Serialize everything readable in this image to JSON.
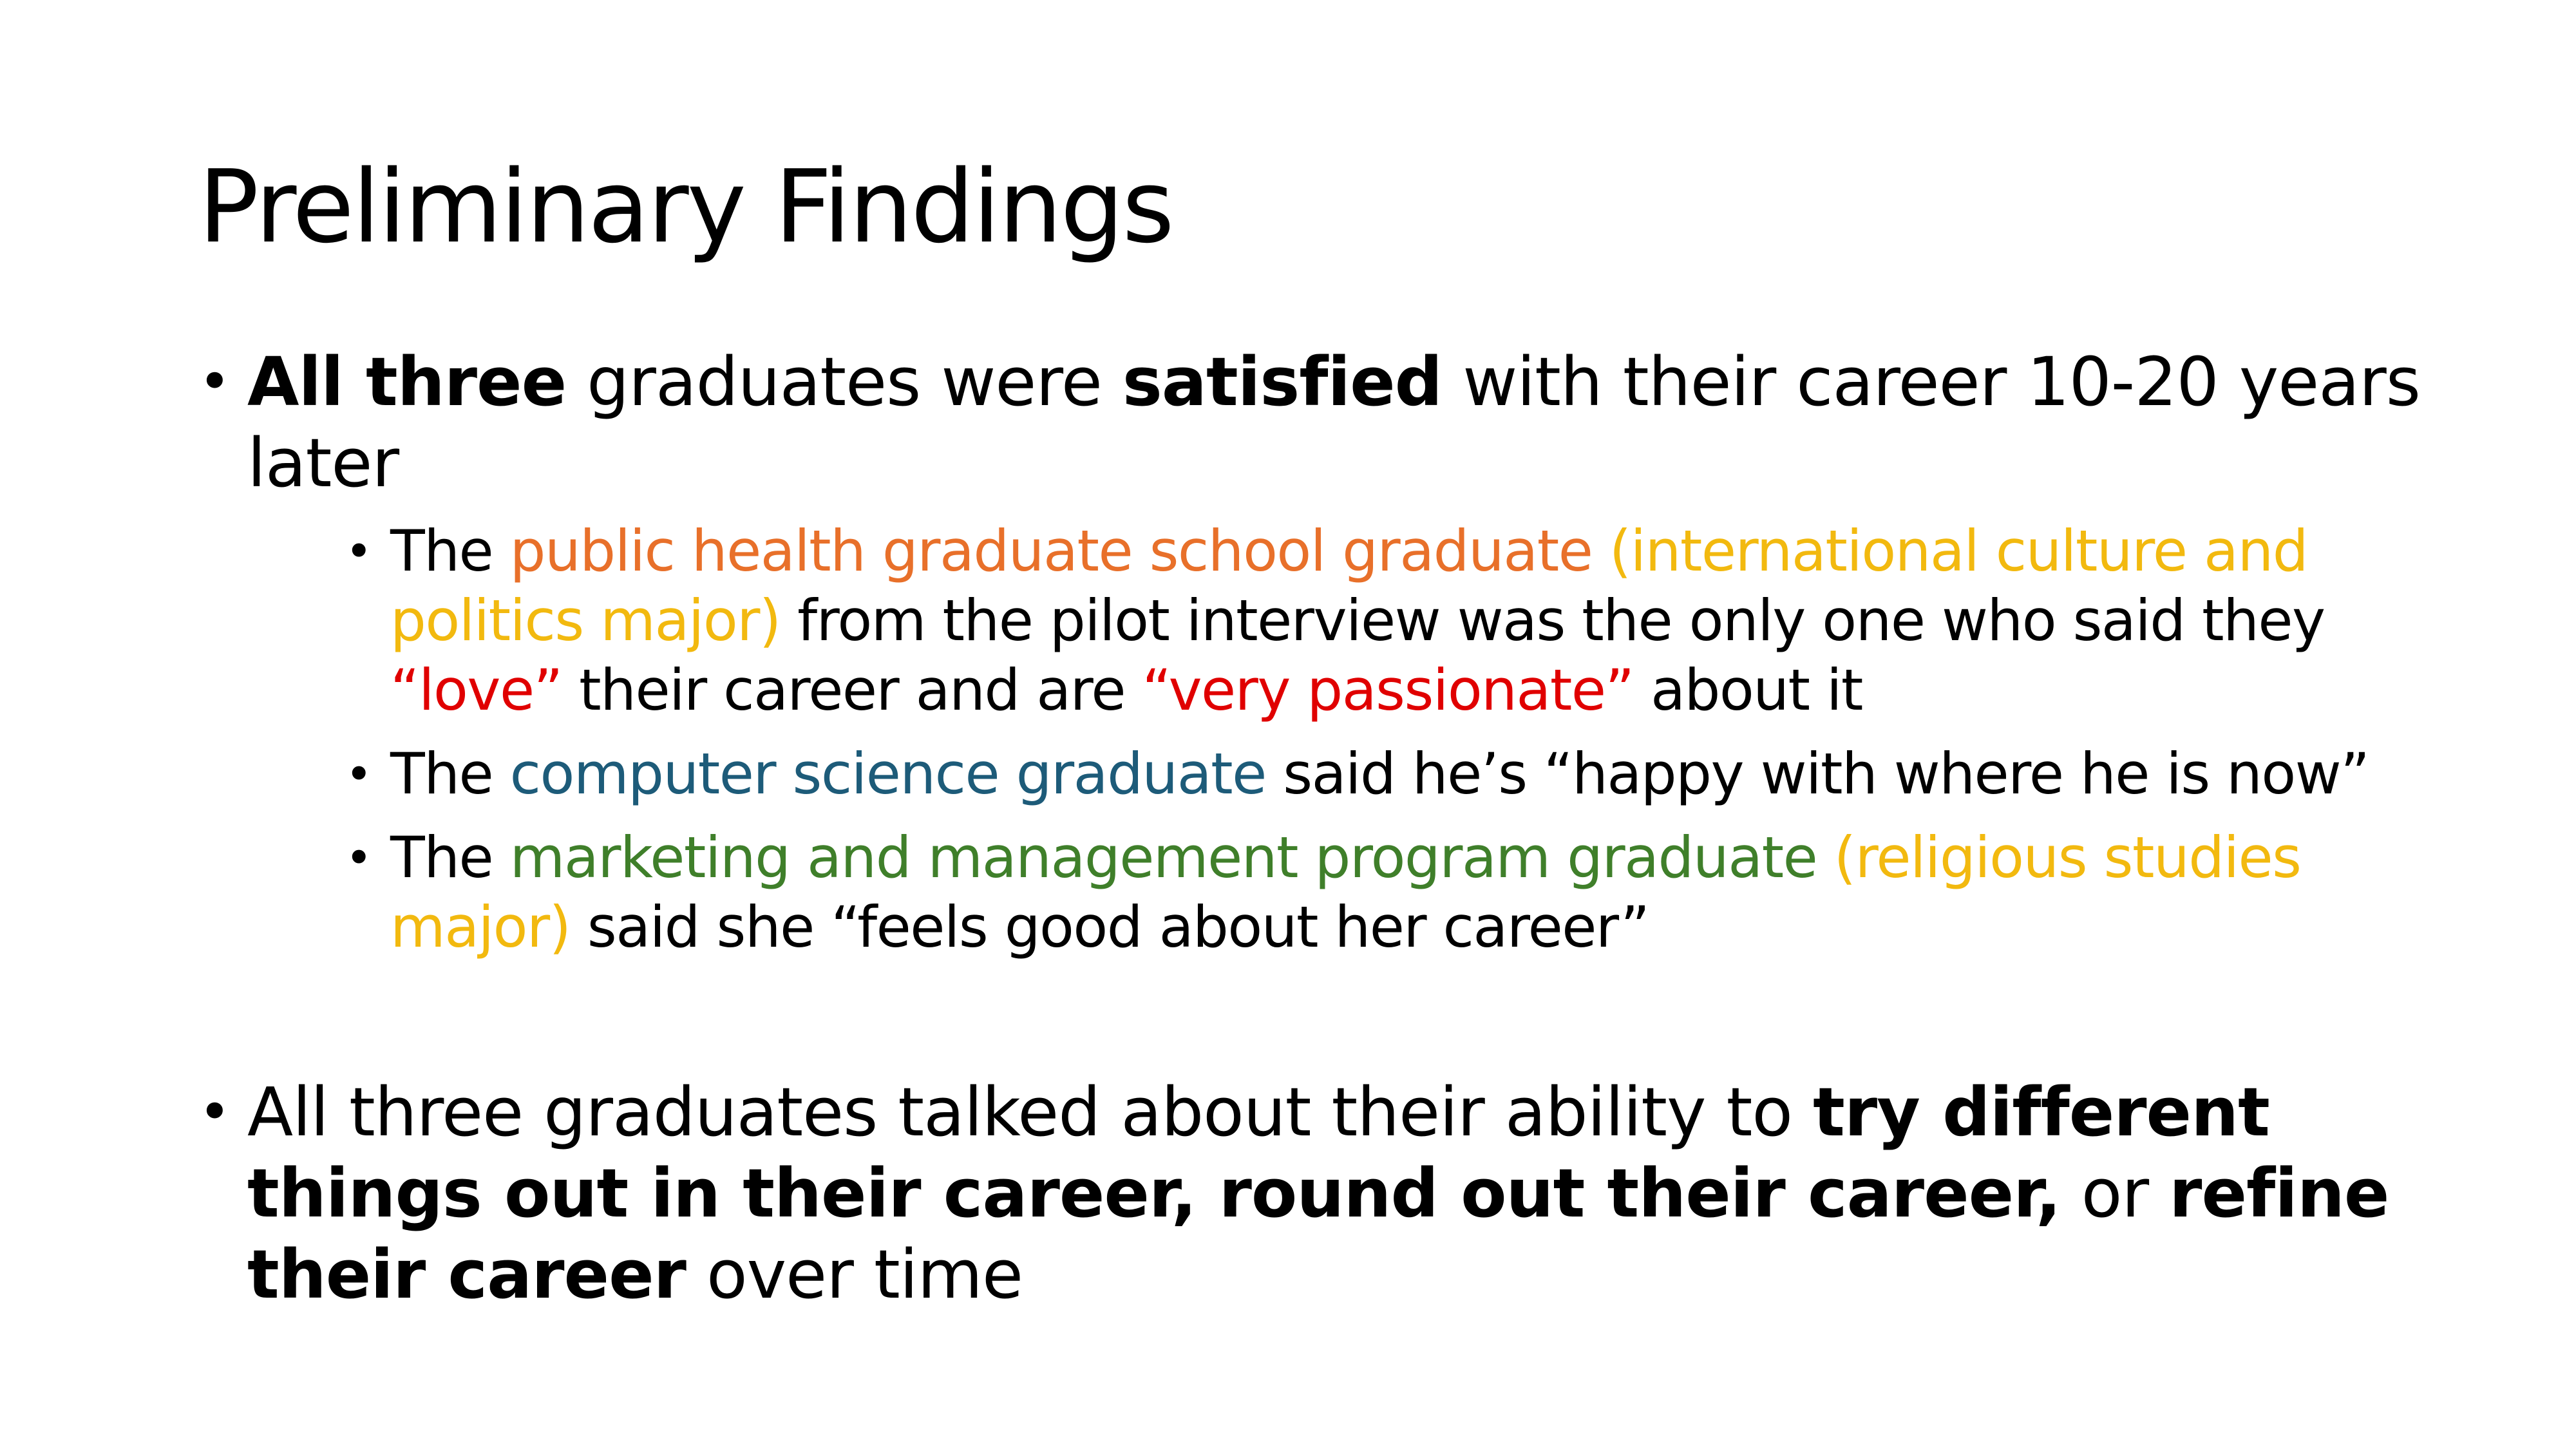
{
  "slide": {
    "title": "Preliminary Findings",
    "colors": {
      "orange": "#E8702A",
      "gold": "#F2B90F",
      "red": "#E00000",
      "teal": "#1D5B79",
      "green": "#3F7F2A",
      "text": "#000000",
      "background": "#FFFFFF"
    },
    "bullet_glyph": "•",
    "bullet1": {
      "bold_lead": "All three",
      "text_1": " graduates were ",
      "bold_2": "satisfied",
      "text_2": " with their career 10-20 years later",
      "sub1": {
        "prefix": "The ",
        "orange": "public health graduate school graduate",
        "space": " ",
        "gold": "(international culture and politics major)",
        "text_1": " from the pilot interview was the only one who said they ",
        "red_1": "“love”",
        "text_2": " their career and are ",
        "red_2": "“very passionate”",
        "text_3": " about it"
      },
      "sub2": {
        "prefix": "The ",
        "teal": "computer science graduate",
        "text": " said he’s “happy with where he is now”"
      },
      "sub3": {
        "prefix": "The ",
        "green": "marketing and management program graduate",
        "space": " ",
        "gold": "(religious studies major)",
        "text": " said she “feels good about her career”"
      }
    },
    "bullet2": {
      "text_1": "All three graduates talked about their ability to ",
      "bold_1": "try different things out in their career, round out their career,",
      "text_2": " or ",
      "bold_2": "refine their career",
      "text_3": " over time"
    }
  }
}
